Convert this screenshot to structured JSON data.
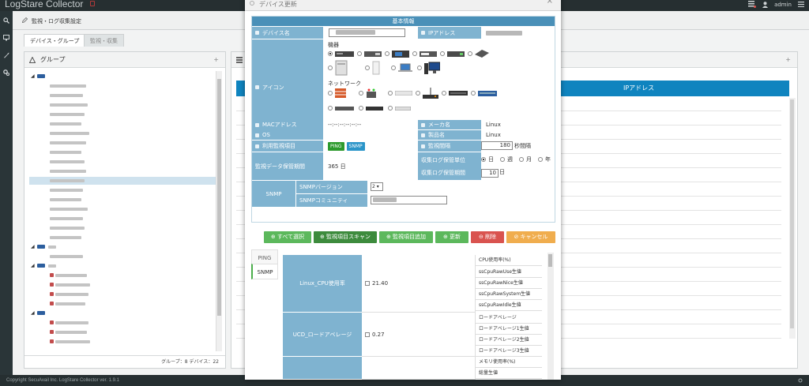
{
  "app": {
    "title": "LogStare Collector",
    "user": "admin",
    "copyright": "Copyright SecuAvail Inc. LogStare Collector ver. 1.9.1"
  },
  "breadcrumb": "監視・ログ収集設定",
  "tabs": [
    "デバイス・グループ",
    "監視・収集"
  ],
  "group_panel": {
    "title": "グループ",
    "footer": "グループ：8 デバイス：22"
  },
  "main_table": {
    "column_ip": "IPアドレス"
  },
  "modal": {
    "title": "デバイス更新",
    "section_title": "基本情報",
    "labels": {
      "device_name": "デバイス名",
      "ip_address": "IPアドレス",
      "icon": "アイコン",
      "mac": "MACアドレス",
      "maker": "メーカ名",
      "os": "OS",
      "product": "製品名",
      "monitor_items": "利用監視項目",
      "interval": "監視間隔",
      "retention": "監視データ保管期間",
      "log_unit": "収集ログ保管単位",
      "log_period": "収集ログ保管期間",
      "snmp": "SNMP",
      "snmp_version": "SNMPバージョン",
      "snmp_community": "SNMPコミュニティ"
    },
    "icon_groups": {
      "machine": "機器",
      "network": "ネットワーク"
    },
    "values": {
      "mac": "--:--:--:--:--:--",
      "maker": "Linux",
      "product": "Linux",
      "interval": "180",
      "interval_unit": "秒間隔",
      "retention": "365 日",
      "log_period": "10",
      "log_period_unit": "日",
      "snmp_version": "2 ▾"
    },
    "chips": [
      "PING",
      "SNMP"
    ],
    "log_units": [
      "日",
      "週",
      "月",
      "年"
    ],
    "buttons": {
      "select_all": "⊕ すべて選択",
      "scan": "⊕ 監視項目スキャン",
      "add": "⊕ 監視項目追加",
      "update": "⊕ 更新",
      "delete": "⊖ 削除",
      "cancel": "⊘ キャンセル"
    },
    "side_tabs": [
      "PING",
      "SNMP"
    ],
    "items": [
      {
        "name": "Linux_CPU使用率",
        "value": "21.40",
        "metrics": [
          "CPU使用率(%)",
          "ssCpuRawUse生値",
          "ssCpuRawNice生値",
          "ssCpuRawSystem生値",
          "ssCpuRawIdle生値"
        ]
      },
      {
        "name": "UCD_ロードアベレージ",
        "value": "0.27",
        "metrics": [
          "ロードアベレージ",
          "ロードアベレージ1生値",
          "ロードアベレージ2生値",
          "ロードアベレージ3生値"
        ]
      },
      {
        "name": "",
        "value": "",
        "metrics": [
          "メモリ使用率(%)",
          "総量生値"
        ]
      }
    ]
  },
  "colors": {
    "header_blue": "#4a90b8",
    "label_blue": "#7fb3d0",
    "table_head": "#0f84bf",
    "btn_green": "#5cb85c",
    "btn_green_dark": "#3d8b3d",
    "btn_red": "#d9534f",
    "btn_orange": "#f0ad4e"
  }
}
